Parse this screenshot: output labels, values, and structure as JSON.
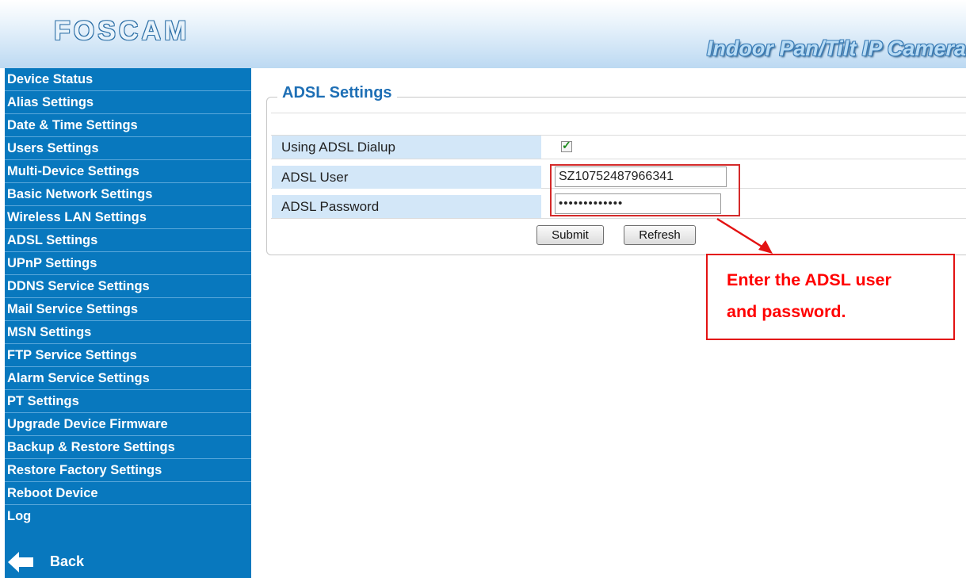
{
  "header": {
    "logo": "FOSCAM",
    "product": "Indoor Pan/Tilt IP Camera"
  },
  "sidebar": {
    "items": [
      {
        "label": "Device Status"
      },
      {
        "label": "Alias Settings"
      },
      {
        "label": "Date & Time Settings"
      },
      {
        "label": "Users Settings"
      },
      {
        "label": "Multi-Device Settings"
      },
      {
        "label": "Basic Network Settings"
      },
      {
        "label": "Wireless LAN Settings"
      },
      {
        "label": "ADSL Settings"
      },
      {
        "label": "UPnP Settings"
      },
      {
        "label": "DDNS Service Settings"
      },
      {
        "label": "Mail Service Settings"
      },
      {
        "label": "MSN Settings"
      },
      {
        "label": "FTP Service Settings"
      },
      {
        "label": "Alarm Service Settings"
      },
      {
        "label": "PT Settings"
      },
      {
        "label": "Upgrade Device Firmware"
      },
      {
        "label": "Backup & Restore Settings"
      },
      {
        "label": "Restore Factory Settings"
      },
      {
        "label": "Reboot Device"
      },
      {
        "label": "Log"
      }
    ],
    "back_label": "Back"
  },
  "main": {
    "section_title": "ADSL Settings",
    "rows": {
      "dialup_label": "Using ADSL Dialup",
      "dialup_checked": true,
      "user_label": "ADSL User",
      "user_value": "SZ10752487966341",
      "password_label": "ADSL Password",
      "password_masked": "•••••••••••••"
    },
    "submit_label": "Submit",
    "refresh_label": "Refresh"
  },
  "annotation": {
    "line1": "Enter the ADSL user",
    "line2": "and password."
  },
  "colors": {
    "sidebar_bg": "#0878be",
    "title_blue": "#1e6fb5",
    "label_cell_bg": "#d3e7f8",
    "annotation_red": "#ff0000"
  }
}
